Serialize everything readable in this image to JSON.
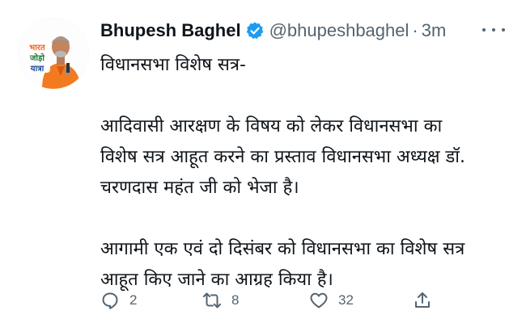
{
  "tweet": {
    "author_name": "Bhupesh Baghel",
    "handle": "@bhupeshbaghel",
    "separator": "·",
    "time": "3m",
    "avatar_badge_lines": [
      "भारत",
      "जोड़ो",
      "यात्रा"
    ],
    "body": {
      "line1": "विधानसभा विशेष सत्र-",
      "para1": [
        "आदिवासी आरक्षण के विषय को लेकर विधानसभा का",
        "विशेष सत्र आहूत करने का प्रस्ताव विधानसभा अध्यक्ष डॉ.",
        "चरणदास महंत जी को भेजा है।"
      ],
      "para2": [
        "आगामी एक एवं दो दिसंबर को विधानसभा का विशेष सत्र",
        "आहूत किए जाने का आग्रह किया है।"
      ]
    },
    "actions": {
      "reply_count": "2",
      "retweet_count": "8",
      "like_count": "32"
    }
  },
  "colors": {
    "text": "#0f1419",
    "secondary": "#536471",
    "verified": "#1d9bf0",
    "badge_orange": "#f26522"
  },
  "icons": {
    "verified": "verified-badge-icon",
    "more": "more-options-icon",
    "reply": "reply-icon",
    "retweet": "retweet-icon",
    "like": "like-icon",
    "share": "share-icon"
  }
}
